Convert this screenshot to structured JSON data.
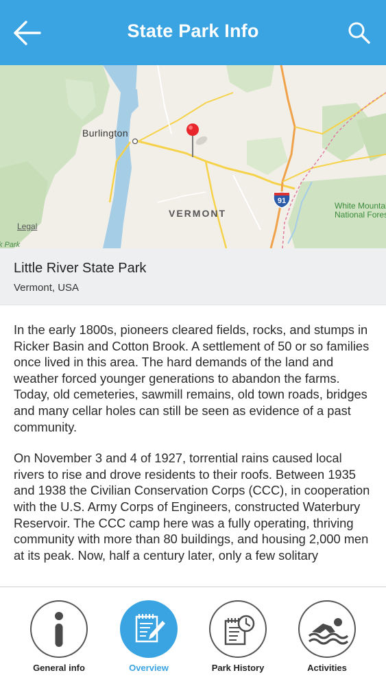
{
  "header": {
    "title": "State Park Info",
    "back_icon": "arrow-left-icon",
    "search_icon": "search-icon",
    "background": "#3aa4e3"
  },
  "map": {
    "city_label": "Burlington",
    "state_label": "VERMONT",
    "legal_link": "Legal",
    "forest_label_line1": "White Mountain",
    "forest_label_line2": "National Forest",
    "park_label": "k Park",
    "interstate_number": "91",
    "marker_icon": "map-pin-icon"
  },
  "park": {
    "name": "Little River State Park",
    "location": "Vermont, USA"
  },
  "description": {
    "paragraph1": "In the early 1800s, pioneers cleared fields, rocks, and stumps in Ricker Basin and Cotton Brook. A settlement of 50 or so families once lived in this area. The hard demands of the land and weather forced younger generations to abandon the farms. Today, old cemeteries, sawmill remains, old town roads, bridges and many cellar holes can still be seen as evidence of a past community.",
    "paragraph2": "On November 3 and 4 of 1927, torrential rains caused local rivers to rise and drove residents to their roofs. Between 1935 and 1938 the Civilian Conservation Corps (CCC), in cooperation with the U.S. Army Corps of Engineers, constructed Waterbury Reservoir. The CCC camp here was a fully operating, thriving community with more than 80 buildings, and housing 2,000 men at its peak. Now, half a century later, only a few solitary"
  },
  "nav": {
    "items": [
      {
        "label": "General info",
        "icon": "info-icon",
        "active": false
      },
      {
        "label": "Overview",
        "icon": "notepad-pencil-icon",
        "active": true
      },
      {
        "label": "Park History",
        "icon": "history-clock-icon",
        "active": false
      },
      {
        "label": "Activities",
        "icon": "swimmer-icon",
        "active": false
      }
    ],
    "accent_color": "#3aa4e3"
  }
}
